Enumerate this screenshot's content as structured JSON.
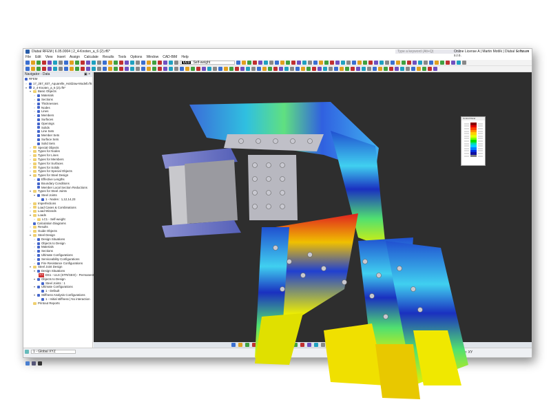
{
  "title": "Dlubal RFEM | 6.05.0004 | 2_4-Knoten_a_6 (2).rf6*",
  "search_placeholder": "Type a keyword (Alt+Q)",
  "license": "Online License A | Martin Motlík | Dlubal Software s.r.o.",
  "menu": [
    "File",
    "Edit",
    "View",
    "Insert",
    "Assign",
    "Calculate",
    "Results",
    "Tools",
    "Options",
    "Window",
    "CAD-BIM",
    "Help"
  ],
  "toolbar": {
    "load_case": "LC1",
    "load_case_name": "Self-weight"
  },
  "navigator": {
    "title": "Navigator - Data",
    "root": "RFEM",
    "items": [
      {
        "label": "17_257_837_Aquarelle_Holdzaw-Modell.rf6",
        "lvl": 0,
        "ex": ">"
      },
      {
        "label": "2_4-Knoten_a_6 (2).rf6*",
        "lvl": 0,
        "ex": "v"
      },
      {
        "label": "Basic Objects",
        "lvl": 1,
        "ex": "v",
        "f": 1
      },
      {
        "label": "Materials",
        "lvl": 2,
        "ex": ">"
      },
      {
        "label": "Sections",
        "lvl": 2,
        "ex": ">"
      },
      {
        "label": "Thicknesses",
        "lvl": 2,
        "ex": ">"
      },
      {
        "label": "Nodes",
        "lvl": 2,
        "ex": ">"
      },
      {
        "label": "Lines",
        "lvl": 2,
        "ex": ">"
      },
      {
        "label": "Members",
        "lvl": 2,
        "ex": ">"
      },
      {
        "label": "Surfaces",
        "lvl": 2,
        "ex": ""
      },
      {
        "label": "Openings",
        "lvl": 2,
        "ex": ""
      },
      {
        "label": "Solids",
        "lvl": 2,
        "ex": ""
      },
      {
        "label": "Line Sets",
        "lvl": 2,
        "ex": ""
      },
      {
        "label": "Member Sets",
        "lvl": 2,
        "ex": ""
      },
      {
        "label": "Surface Sets",
        "lvl": 2,
        "ex": ""
      },
      {
        "label": "Solid Sets",
        "lvl": 2,
        "ex": ""
      },
      {
        "label": "Special Objects",
        "lvl": 1,
        "ex": ">",
        "f": 1
      },
      {
        "label": "Types for Nodes",
        "lvl": 1,
        "ex": ">",
        "f": 1
      },
      {
        "label": "Types for Lines",
        "lvl": 1,
        "ex": ">",
        "f": 1
      },
      {
        "label": "Types for Members",
        "lvl": 1,
        "ex": ">",
        "f": 1
      },
      {
        "label": "Types for Surfaces",
        "lvl": 1,
        "ex": ">",
        "f": 1
      },
      {
        "label": "Types for Solids",
        "lvl": 1,
        "ex": ">",
        "f": 1
      },
      {
        "label": "Types for Special Objects",
        "lvl": 1,
        "ex": ">",
        "f": 1
      },
      {
        "label": "Types for Steel Design",
        "lvl": 1,
        "ex": "v",
        "f": 1
      },
      {
        "label": "Effective Lengths",
        "lvl": 2,
        "ex": ">"
      },
      {
        "label": "Boundary Conditions",
        "lvl": 2,
        "ex": ""
      },
      {
        "label": "Member Local Section Reductions",
        "lvl": 2,
        "ex": ""
      },
      {
        "label": "Types for Steel Joints",
        "lvl": 1,
        "ex": "v",
        "f": 1
      },
      {
        "label": "Steel Joints",
        "lvl": 2,
        "ex": "v"
      },
      {
        "label": "1 - Nodes : 1,12,14,23",
        "lvl": 3,
        "ex": ""
      },
      {
        "label": "Imperfections",
        "lvl": 1,
        "ex": ">",
        "f": 1
      },
      {
        "label": "Load Cases & Combinations",
        "lvl": 1,
        "ex": ">",
        "f": 1
      },
      {
        "label": "Load Wizards",
        "lvl": 1,
        "ex": ">",
        "f": 1
      },
      {
        "label": "Loads",
        "lvl": 1,
        "ex": "v",
        "f": 1
      },
      {
        "label": "LC1 - Self-weight",
        "lvl": 2,
        "ex": ">",
        "f": 1
      },
      {
        "label": "Calculation Diagrams",
        "lvl": 1,
        "ex": ""
      },
      {
        "label": "Results",
        "lvl": 1,
        "ex": ">",
        "f": 1
      },
      {
        "label": "Guide Objects",
        "lvl": 1,
        "ex": ">",
        "f": 1
      },
      {
        "label": "Steel Design",
        "lvl": 1,
        "ex": "v",
        "f": 1
      },
      {
        "label": "Design Situations",
        "lvl": 2,
        "ex": ">"
      },
      {
        "label": "Objects to Design",
        "lvl": 2,
        "ex": ">"
      },
      {
        "label": "Materials",
        "lvl": 2,
        "ex": ">"
      },
      {
        "label": "Sections",
        "lvl": 2,
        "ex": ">"
      },
      {
        "label": "Ultimate Configurations",
        "lvl": 2,
        "ex": ">"
      },
      {
        "label": "Serviceability Configurations",
        "lvl": 2,
        "ex": ">"
      },
      {
        "label": "Fire Resistance Configurations",
        "lvl": 2,
        "ex": ">"
      },
      {
        "label": "Steel Joint Design",
        "lvl": 1,
        "ex": "v",
        "f": 1
      },
      {
        "label": "Design Situations",
        "lvl": 2,
        "ex": "v"
      },
      {
        "label": "DS1 - ULS (STR/GEO) - Permanent ...",
        "lvl": 3,
        "ex": "",
        "badge": "ULS"
      },
      {
        "label": "Objects to Design",
        "lvl": 2,
        "ex": "v"
      },
      {
        "label": "Steel Joints : 1",
        "lvl": 3,
        "ex": ""
      },
      {
        "label": "Ultimate Configurations",
        "lvl": 2,
        "ex": "v"
      },
      {
        "label": "1 - Default",
        "lvl": 3,
        "ex": ""
      },
      {
        "label": "Stiffness Analysis Configurations",
        "lvl": 2,
        "ex": "v"
      },
      {
        "label": "1 - Initial stiffness | No interaction",
        "lvl": 3,
        "ex": ""
      },
      {
        "label": "Printout Reports",
        "lvl": 1,
        "ex": "",
        "f": 1
      }
    ]
  },
  "status": {
    "coord_system": "1 - Global XYZ",
    "plane": "Plane: XY"
  },
  "legend": {
    "title": "Control Panel",
    "colors": [
      "#8b0000",
      "#e00000",
      "#ff4000",
      "#ff9000",
      "#ffd000",
      "#e0ff00",
      "#80ff00",
      "#00e000",
      "#00e0a0",
      "#00d0ff",
      "#0080ff",
      "#0030e0",
      "#1010a0",
      "#808080"
    ]
  }
}
